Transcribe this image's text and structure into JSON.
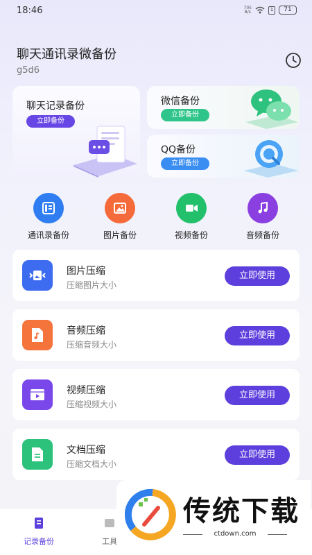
{
  "status_bar": {
    "time": "18:46",
    "net_speed_top": "705",
    "net_speed_bottom": "B/s",
    "sim": "1",
    "battery": "71"
  },
  "header": {
    "title": "聊天通讯录微备份",
    "user_id": "g5d6"
  },
  "feature_cards": {
    "chat": {
      "title": "聊天记录备份",
      "button": "立即备份"
    },
    "wechat": {
      "title": "微信备份",
      "button": "立即备份"
    },
    "qq": {
      "title": "QQ备份",
      "button": "立即备份"
    }
  },
  "categories": [
    {
      "label": "通讯录备份",
      "icon": "contacts-icon",
      "color": "#2f7df0"
    },
    {
      "label": "图片备份",
      "icon": "image-icon",
      "color": "#f56a3a"
    },
    {
      "label": "视频备份",
      "icon": "video-icon",
      "color": "#22c06a"
    },
    {
      "label": "音频备份",
      "icon": "music-icon",
      "color": "#8a3fe0"
    }
  ],
  "tools": [
    {
      "title": "图片压缩",
      "subtitle": "压缩图片大小",
      "button": "立即使用",
      "icon": "image-compress-icon",
      "color": "#3d6cf0"
    },
    {
      "title": "音频压缩",
      "subtitle": "压缩音频大小",
      "button": "立即使用",
      "icon": "audio-file-icon",
      "color": "#f5743c"
    },
    {
      "title": "视频压缩",
      "subtitle": "压缩视频大小",
      "button": "立即使用",
      "icon": "video-file-icon",
      "color": "#7a47ea"
    },
    {
      "title": "文档压缩",
      "subtitle": "压缩文档大小",
      "button": "立即使用",
      "icon": "document-icon",
      "color": "#2dc27b"
    }
  ],
  "tab_bar": {
    "tabs": [
      {
        "label": "记录备份",
        "active": true
      },
      {
        "label": "工具"
      }
    ]
  },
  "watermark": {
    "text": "传统下载",
    "url": "ctdown.com"
  },
  "colors": {
    "accent": "#5c3fdc",
    "text": "#222222",
    "muted": "#888888"
  }
}
